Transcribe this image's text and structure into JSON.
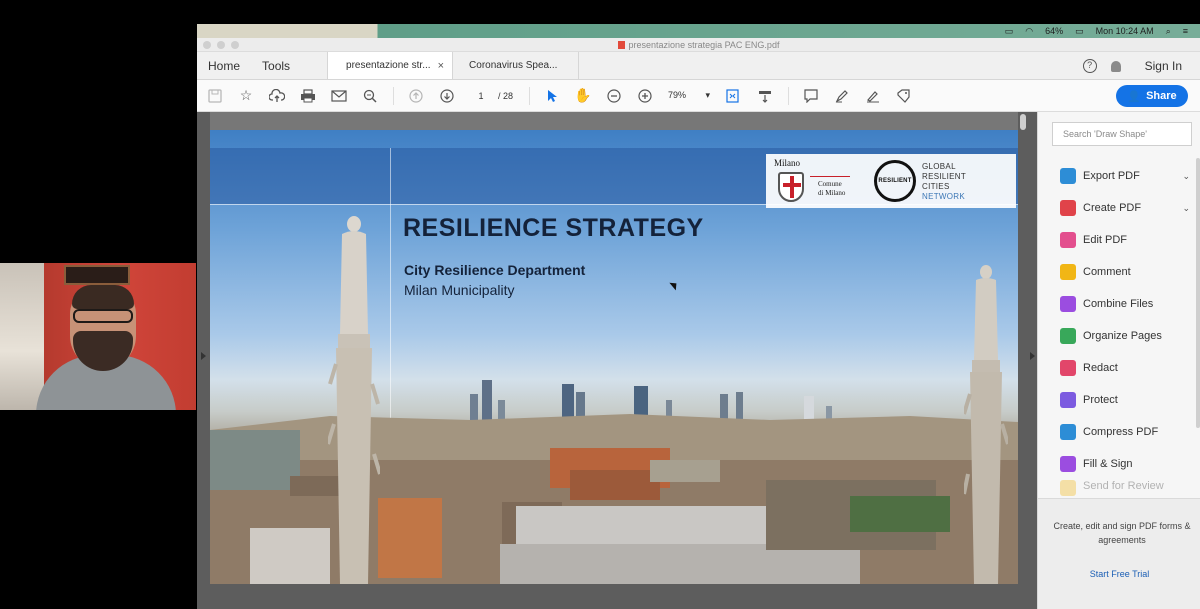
{
  "menubar": {
    "battery": "64%",
    "clock": "Mon 10:24 AM"
  },
  "window": {
    "title": "presentazione strategia PAC ENG.pdf"
  },
  "nav": {
    "home": "Home",
    "tools": "Tools",
    "tabs": [
      {
        "label": "presentazione str...",
        "close": "×"
      },
      {
        "label": "Coronavirus Spea..."
      }
    ],
    "help": "?",
    "sign_in": "Sign In"
  },
  "toolbar": {
    "page_current": "1",
    "page_total": "/ 28",
    "zoom": "79%",
    "zoom_caret": "▾",
    "share": "Share"
  },
  "slide": {
    "milano_word": "Milano",
    "milano_sub": "Comune\ndi Milano",
    "resilient_badge": "RESILIENT",
    "grcn_line1": "GLOBAL",
    "grcn_line2": "RESILIENT",
    "grcn_line3": "CITIES",
    "grcn_line4": "NETWORK",
    "title": "RESILIENCE STRATEGY",
    "subtitle1": "City Resilience Department",
    "subtitle2": "Milan Municipality"
  },
  "right_pane": {
    "search_placeholder": "Search 'Draw Shape'",
    "tools": [
      {
        "label": "Export PDF",
        "color": "#2d8dd6",
        "chevron": "⌄"
      },
      {
        "label": "Create PDF",
        "color": "#e0434a",
        "chevron": "⌄"
      },
      {
        "label": "Edit PDF",
        "color": "#e34f8e"
      },
      {
        "label": "Comment",
        "color": "#f1b615"
      },
      {
        "label": "Combine Files",
        "color": "#9b4de0"
      },
      {
        "label": "Organize Pages",
        "color": "#38a85a"
      },
      {
        "label": "Redact",
        "color": "#e2466a"
      },
      {
        "label": "Protect",
        "color": "#7c5be0"
      },
      {
        "label": "Compress PDF",
        "color": "#2d8dd6"
      },
      {
        "label": "Fill & Sign",
        "color": "#9b4de0"
      },
      {
        "label": "Send for Review",
        "color": "#f1b615"
      }
    ],
    "promo": "Create, edit and sign PDF forms & agreements",
    "trial": "Start Free Trial"
  }
}
